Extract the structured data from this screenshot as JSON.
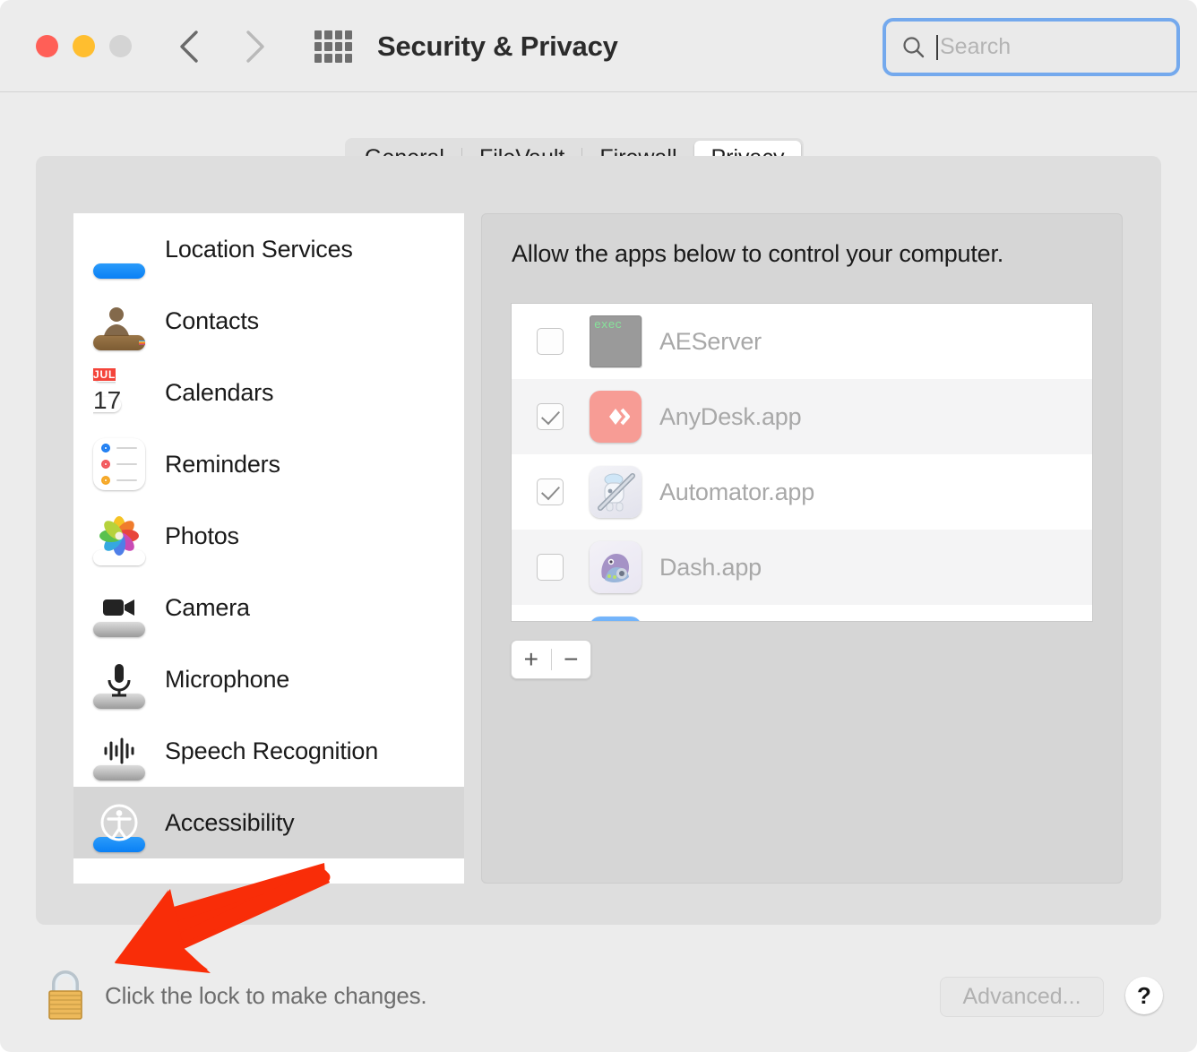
{
  "window": {
    "title": "Security & Privacy",
    "traffic_lights": [
      "close",
      "minimize",
      "zoom-disabled"
    ],
    "nav": {
      "back_icon": "chevron-left-icon",
      "forward_icon": "chevron-right-icon",
      "grid_icon": "grid-all-prefs-icon"
    }
  },
  "search": {
    "placeholder": "Search",
    "value": "",
    "icon": "search-icon",
    "focused": true,
    "accent": "#74a9ed"
  },
  "tabs": [
    {
      "label": "General",
      "selected": false
    },
    {
      "label": "FileVault",
      "selected": false
    },
    {
      "label": "Firewall",
      "selected": false
    },
    {
      "label": "Privacy",
      "selected": true
    }
  ],
  "sidebar": {
    "items": [
      {
        "label": "Location Services",
        "icon": "location-services-icon",
        "selected": false
      },
      {
        "label": "Contacts",
        "icon": "contacts-icon",
        "selected": false
      },
      {
        "label": "Calendars",
        "icon": "calendar-icon",
        "selected": false,
        "icon_month": "JUL",
        "icon_day": "17"
      },
      {
        "label": "Reminders",
        "icon": "reminders-icon",
        "selected": false
      },
      {
        "label": "Photos",
        "icon": "photos-icon",
        "selected": false
      },
      {
        "label": "Camera",
        "icon": "camera-icon",
        "selected": false
      },
      {
        "label": "Microphone",
        "icon": "microphone-icon",
        "selected": false
      },
      {
        "label": "Speech Recognition",
        "icon": "speech-recognition-icon",
        "selected": false
      },
      {
        "label": "Accessibility",
        "icon": "accessibility-icon",
        "selected": true
      }
    ]
  },
  "detail": {
    "heading": "Allow the apps below to control your computer.",
    "apps": [
      {
        "name": "AEServer",
        "checked": false,
        "icon": "exec-binary-icon",
        "icon_text": "exec"
      },
      {
        "name": "AnyDesk.app",
        "checked": true,
        "icon": "anydesk-icon"
      },
      {
        "name": "Automator.app",
        "checked": true,
        "icon": "automator-robot-icon"
      },
      {
        "name": "Dash.app",
        "checked": false,
        "icon": "dash-icon"
      },
      {
        "name": "",
        "checked": false,
        "icon": "partial-row-icon"
      }
    ],
    "add_label": "+",
    "remove_label": "−"
  },
  "footer": {
    "lock_icon": "closed-padlock-icon",
    "lock_text": "Click the lock to make changes.",
    "advanced_label": "Advanced...",
    "advanced_enabled": false,
    "help_label": "?"
  },
  "annotation": {
    "type": "arrow",
    "color": "#f92d08",
    "points_to": "lock-icon"
  }
}
